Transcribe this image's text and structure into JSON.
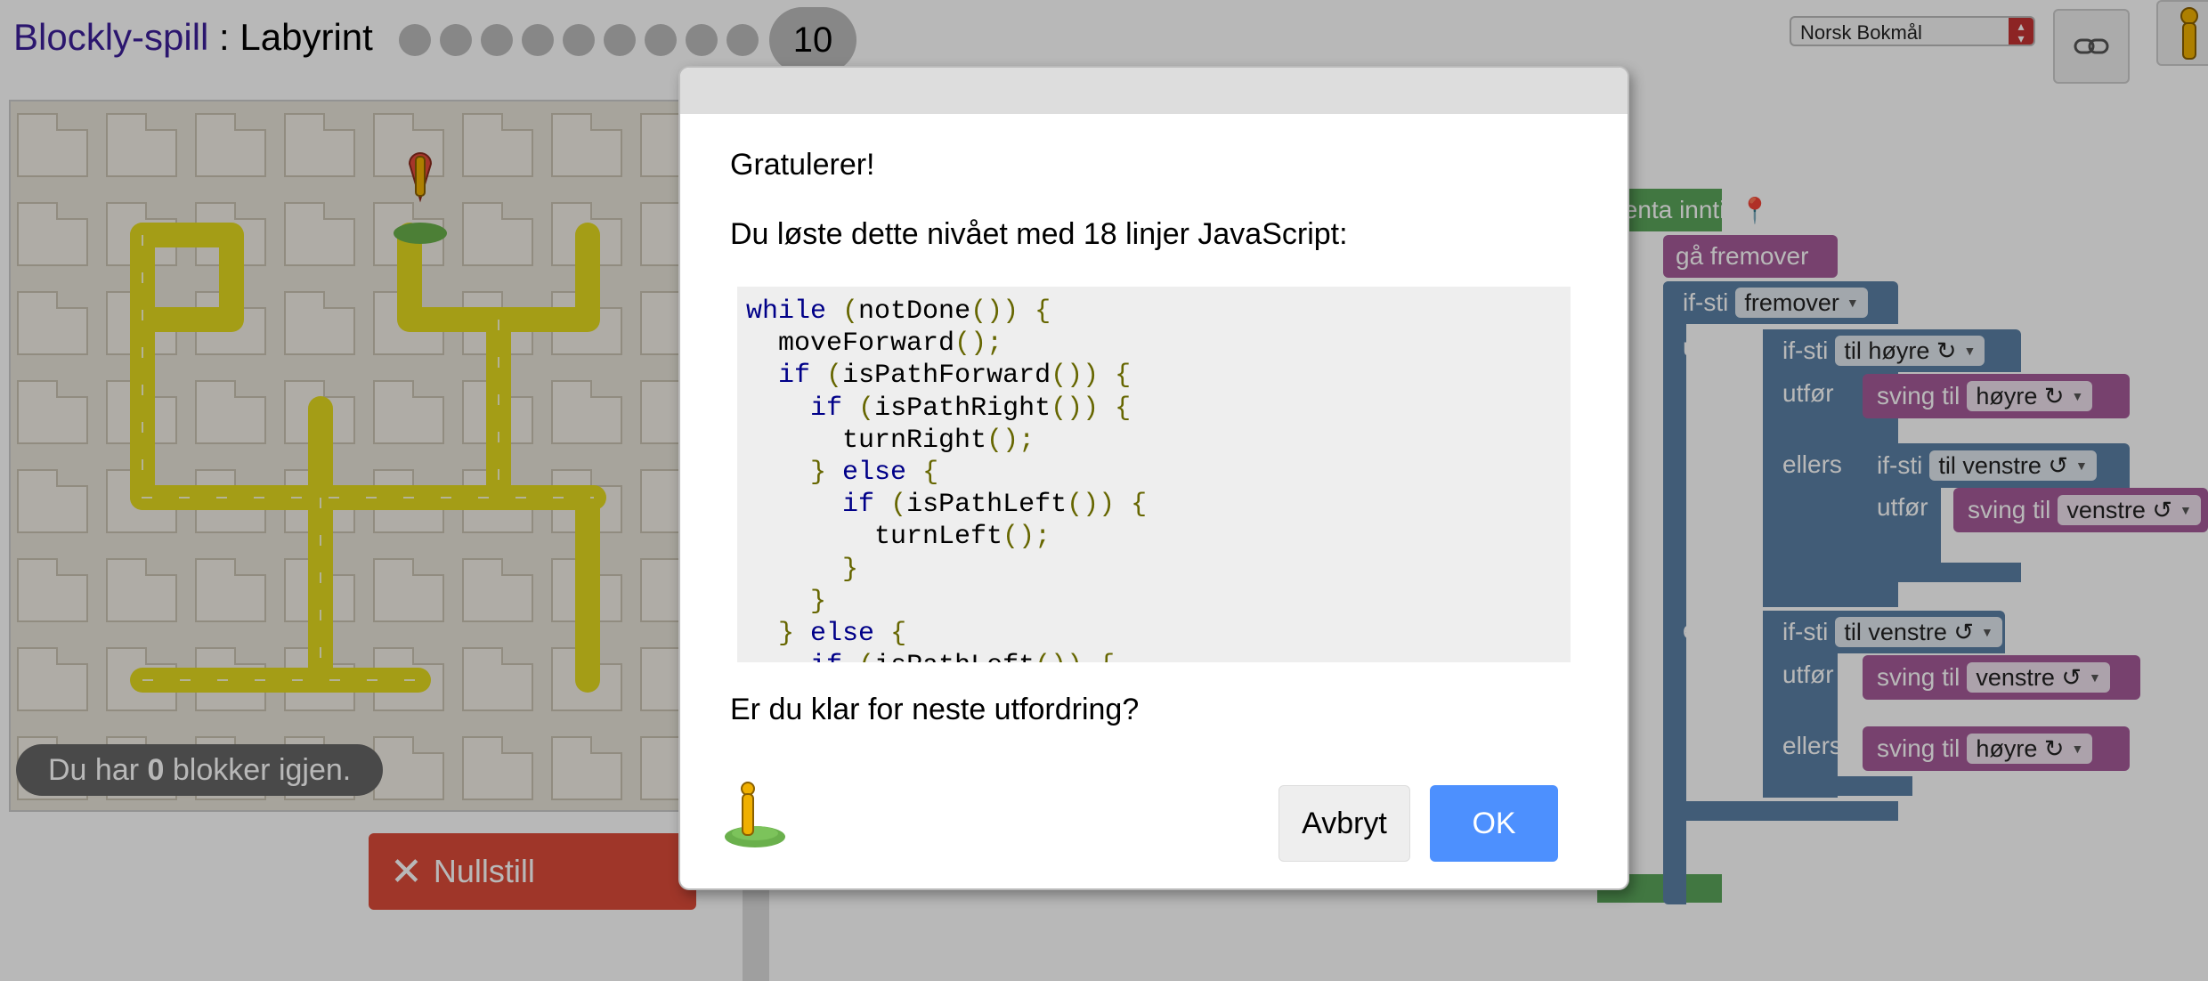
{
  "header": {
    "brand": "Blockly-spill",
    "separator": " : ",
    "game_name": "Labyrint",
    "current_level": "10",
    "language": "Norsk Bokmål"
  },
  "maze": {
    "blocks_left_prefix": "Du har",
    "blocks_left_count": "0",
    "blocks_left_suffix": "blokker igjen.",
    "reset_label": "Nullstill",
    "reset_icon": "close-icon"
  },
  "workspace": {
    "repeat_label": "gjenta inntil",
    "move_forward": "gå fremover",
    "if_path": "if-sti",
    "do_label": "utfør",
    "else_label": "ellers",
    "turn_label": "sving til",
    "dir_forward": "fremover",
    "dir_right": "til høyre ↻",
    "dir_left": "til venstre ↺",
    "right_value": "høyre ↻",
    "left_value": "venstre ↺"
  },
  "dialog": {
    "heading": "Gratulerer!",
    "message": "Du løste dette nivået med 18 linjer JavaScript:",
    "code_lines": [
      "while (notDone()) {",
      "  moveForward();",
      "  if (isPathForward()) {",
      "    if (isPathRight()) {",
      "      turnRight();",
      "    } else {",
      "      if (isPathLeft()) {",
      "        turnLeft();",
      "      }",
      "    }",
      "  } else {",
      "    if (isPathLeft()) {"
    ],
    "question": "Er du klar for neste utfordring?",
    "cancel_label": "Avbryt",
    "ok_label": "OK"
  },
  "colors": {
    "brand": "#3c1f99",
    "ok_button": "#4d90fe",
    "reset_button": "#dd4b39",
    "path": "#e8e022",
    "loop_block": "#5ba55b",
    "logic_block": "#5b80a5",
    "action_block": "#a55b99"
  }
}
